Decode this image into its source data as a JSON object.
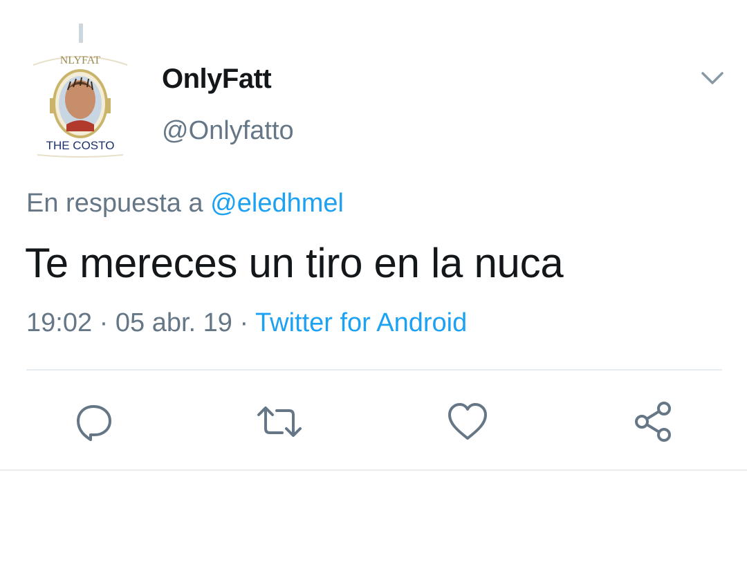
{
  "avatar": {
    "logo_text": "NLYFAT",
    "caption": "THE COSTO"
  },
  "author": {
    "display_name": "OnlyFatt",
    "handle": "@Onlyfatto"
  },
  "reply": {
    "prefix": "En respuesta a ",
    "handle": "@eledhmel"
  },
  "tweet": {
    "text": "Te mereces un tiro en la nuca"
  },
  "meta": {
    "time": "19:02",
    "separator": " · ",
    "date": "05 abr. 19",
    "source": "Twitter for Android"
  },
  "icons": {
    "caret": "chevron-down-icon",
    "reply": "reply-icon",
    "retweet": "retweet-icon",
    "like": "heart-icon",
    "share": "share-icon"
  },
  "colors": {
    "text": "#14171a",
    "secondary": "#657786",
    "link": "#1da1f2",
    "divider": "#e6ecf0"
  }
}
